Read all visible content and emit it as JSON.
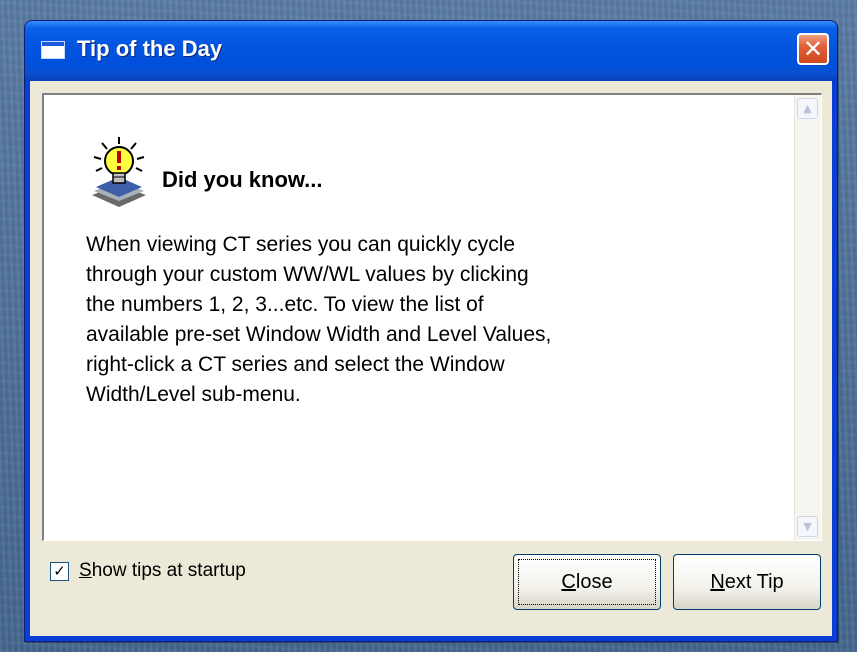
{
  "window": {
    "title": "Tip of the Day"
  },
  "tip": {
    "heading": "Did you know...",
    "body": "When viewing CT series you can quickly cycle\nthrough your custom WW/WL values by clicking\nthe numbers 1, 2, 3...etc. To view the list of\navailable pre-set Window Width and Level Values,\nright-click a CT series and select the Window\nWidth/Level sub-menu."
  },
  "footer": {
    "show_tips_label_accel": "S",
    "show_tips_label_rest": "how tips at startup",
    "show_tips_checked": true,
    "close_accel": "C",
    "close_rest": "lose",
    "next_accel": "N",
    "next_rest": "ext Tip"
  },
  "icons": {
    "window_icon": "window-icon",
    "close": "close-icon",
    "bulb": "lightbulb-icon",
    "scroll_up": "scroll-up-icon",
    "scroll_down": "scroll-down-icon",
    "check": "checkmark-icon"
  },
  "colors": {
    "titlebar": "#0050dc",
    "close_button": "#e0603a",
    "dialog_face": "#ece9d8",
    "desktop": "#4a6c95"
  }
}
